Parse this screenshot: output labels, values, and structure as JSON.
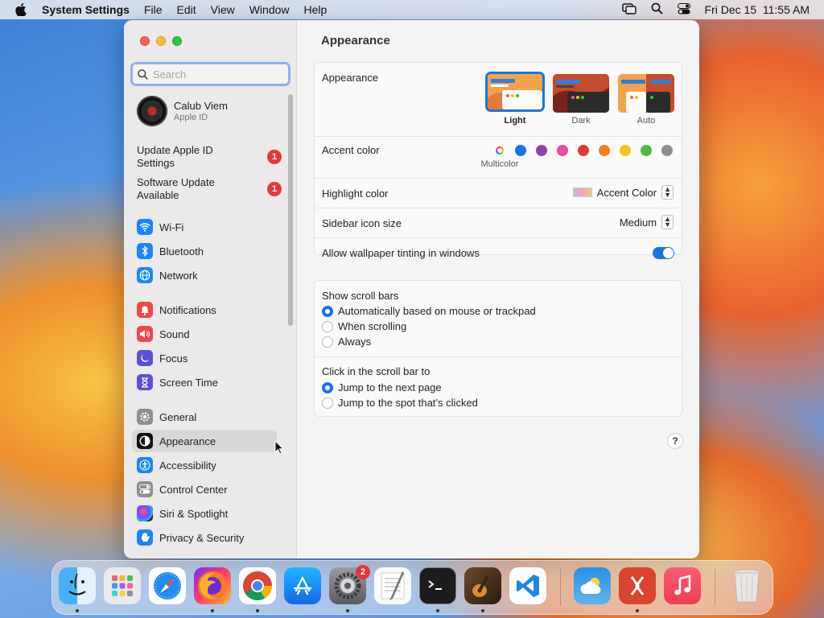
{
  "menubar": {
    "app": "System Settings",
    "items": [
      "File",
      "Edit",
      "View",
      "Window",
      "Help"
    ],
    "datetime": "Fri Dec 15  11:55 AM"
  },
  "sidebar": {
    "search_placeholder": "Search",
    "profile": {
      "name": "Calub Viem",
      "sub": "Apple ID"
    },
    "notices": [
      {
        "label": "Update Apple ID Settings",
        "badge": "1"
      },
      {
        "label": "Software Update Available",
        "badge": "1"
      }
    ],
    "items": [
      {
        "label": "Wi-Fi",
        "icon": "wifi-icon",
        "color": "#1a84ff"
      },
      {
        "label": "Bluetooth",
        "icon": "bluetooth-icon",
        "color": "#1a84ff"
      },
      {
        "label": "Network",
        "icon": "globe-icon",
        "color": "#1a84ff"
      },
      {
        "label": "Notifications",
        "icon": "bell-icon",
        "color": "#f0474a"
      },
      {
        "label": "Sound",
        "icon": "speaker-icon",
        "color": "#f0474a"
      },
      {
        "label": "Focus",
        "icon": "moon-icon",
        "color": "#5b4fd6"
      },
      {
        "label": "Screen Time",
        "icon": "hourglass-icon",
        "color": "#5b4fd6"
      },
      {
        "label": "General",
        "icon": "gear-icon",
        "color": "#8e8e93"
      },
      {
        "label": "Appearance",
        "icon": "appearance-icon",
        "color": "#111111"
      },
      {
        "label": "Accessibility",
        "icon": "accessibility-icon",
        "color": "#1a84ff"
      },
      {
        "label": "Control Center",
        "icon": "switches-icon",
        "color": "#8e8e93"
      },
      {
        "label": "Siri & Spotlight",
        "icon": "siri-icon",
        "color": "#222222"
      },
      {
        "label": "Privacy & Security",
        "icon": "hand-icon",
        "color": "#1a84ff"
      }
    ]
  },
  "main": {
    "title": "Appearance",
    "appearance": {
      "label": "Appearance",
      "options": [
        "Light",
        "Dark",
        "Auto"
      ],
      "selected": "Light"
    },
    "accent": {
      "label": "Accent color",
      "multicolor_label": "Multicolor",
      "colors": [
        "#1a73e8",
        "#8e44ad",
        "#e84c9b",
        "#e53935",
        "#f4821f",
        "#f6c324",
        "#4cbb3f",
        "#8d8d8d"
      ]
    },
    "highlight": {
      "label": "Highlight color",
      "value": "Accent Color"
    },
    "icon_size": {
      "label": "Sidebar icon size",
      "value": "Medium"
    },
    "tinting": {
      "label": "Allow wallpaper tinting in windows",
      "on": true
    },
    "scroll_bars": {
      "label": "Show scroll bars",
      "options": [
        "Automatically based on mouse or trackpad",
        "When scrolling",
        "Always"
      ],
      "selected": 0
    },
    "click_scroll": {
      "label": "Click in the scroll bar to",
      "options": [
        "Jump to the next page",
        "Jump to the spot that’s clicked"
      ],
      "selected": 0
    },
    "help": "?"
  },
  "dock": {
    "settings_badge": "2",
    "apps": [
      "finder",
      "launchpad",
      "safari",
      "firefox",
      "chrome",
      "app-store",
      "system-settings",
      "textedit",
      "terminal",
      "garageband",
      "vscode",
      "weather",
      "remote-desktop",
      "music",
      "trash"
    ]
  }
}
